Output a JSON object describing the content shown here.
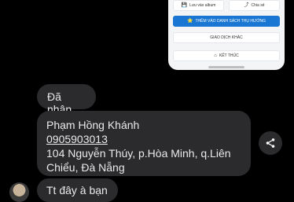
{
  "shared_image": {
    "save_album_label": "Lưu vào album",
    "share_label": "Chia sẻ",
    "add_beneficiary_label": "THÊM VÀO DANH SÁCH THỤ HƯỞNG",
    "other_transaction_label": "GIAO DỊCH KHÁC",
    "finish_label": "KẾT THÚC",
    "primary_color": "#1976d2"
  },
  "messages": [
    {
      "text": "Đã nhận"
    },
    {
      "name": "Phạm Hồng Khánh",
      "phone": "0905903013",
      "address_line1": "104 Nguyễn Thúy, p.Hòa Minh, q.Liên",
      "address_line2": "Chiểu, Đà Nẵng"
    },
    {
      "text": "Tt đây à bạn"
    }
  ],
  "icons": {
    "share": "share-icon",
    "save": "save-icon",
    "star": "star-icon",
    "home": "home-icon"
  }
}
